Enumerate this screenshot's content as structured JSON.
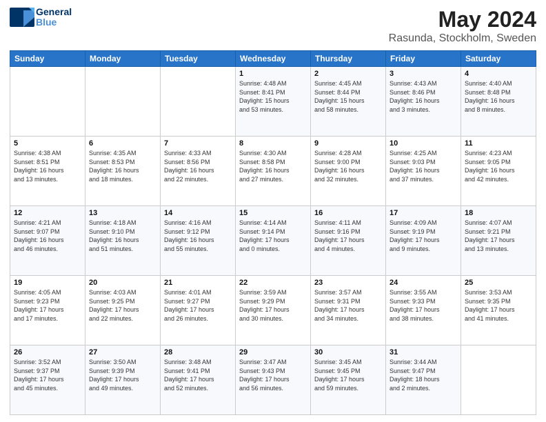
{
  "header": {
    "logo_general": "General",
    "logo_blue": "Blue",
    "main_title": "May 2024",
    "subtitle": "Rasunda, Stockholm, Sweden"
  },
  "days_of_week": [
    "Sunday",
    "Monday",
    "Tuesday",
    "Wednesday",
    "Thursday",
    "Friday",
    "Saturday"
  ],
  "weeks": [
    [
      {
        "day": "",
        "info": ""
      },
      {
        "day": "",
        "info": ""
      },
      {
        "day": "",
        "info": ""
      },
      {
        "day": "1",
        "info": "Sunrise: 4:48 AM\nSunset: 8:41 PM\nDaylight: 15 hours\nand 53 minutes."
      },
      {
        "day": "2",
        "info": "Sunrise: 4:45 AM\nSunset: 8:44 PM\nDaylight: 15 hours\nand 58 minutes."
      },
      {
        "day": "3",
        "info": "Sunrise: 4:43 AM\nSunset: 8:46 PM\nDaylight: 16 hours\nand 3 minutes."
      },
      {
        "day": "4",
        "info": "Sunrise: 4:40 AM\nSunset: 8:48 PM\nDaylight: 16 hours\nand 8 minutes."
      }
    ],
    [
      {
        "day": "5",
        "info": "Sunrise: 4:38 AM\nSunset: 8:51 PM\nDaylight: 16 hours\nand 13 minutes."
      },
      {
        "day": "6",
        "info": "Sunrise: 4:35 AM\nSunset: 8:53 PM\nDaylight: 16 hours\nand 18 minutes."
      },
      {
        "day": "7",
        "info": "Sunrise: 4:33 AM\nSunset: 8:56 PM\nDaylight: 16 hours\nand 22 minutes."
      },
      {
        "day": "8",
        "info": "Sunrise: 4:30 AM\nSunset: 8:58 PM\nDaylight: 16 hours\nand 27 minutes."
      },
      {
        "day": "9",
        "info": "Sunrise: 4:28 AM\nSunset: 9:00 PM\nDaylight: 16 hours\nand 32 minutes."
      },
      {
        "day": "10",
        "info": "Sunrise: 4:25 AM\nSunset: 9:03 PM\nDaylight: 16 hours\nand 37 minutes."
      },
      {
        "day": "11",
        "info": "Sunrise: 4:23 AM\nSunset: 9:05 PM\nDaylight: 16 hours\nand 42 minutes."
      }
    ],
    [
      {
        "day": "12",
        "info": "Sunrise: 4:21 AM\nSunset: 9:07 PM\nDaylight: 16 hours\nand 46 minutes."
      },
      {
        "day": "13",
        "info": "Sunrise: 4:18 AM\nSunset: 9:10 PM\nDaylight: 16 hours\nand 51 minutes."
      },
      {
        "day": "14",
        "info": "Sunrise: 4:16 AM\nSunset: 9:12 PM\nDaylight: 16 hours\nand 55 minutes."
      },
      {
        "day": "15",
        "info": "Sunrise: 4:14 AM\nSunset: 9:14 PM\nDaylight: 17 hours\nand 0 minutes."
      },
      {
        "day": "16",
        "info": "Sunrise: 4:11 AM\nSunset: 9:16 PM\nDaylight: 17 hours\nand 4 minutes."
      },
      {
        "day": "17",
        "info": "Sunrise: 4:09 AM\nSunset: 9:19 PM\nDaylight: 17 hours\nand 9 minutes."
      },
      {
        "day": "18",
        "info": "Sunrise: 4:07 AM\nSunset: 9:21 PM\nDaylight: 17 hours\nand 13 minutes."
      }
    ],
    [
      {
        "day": "19",
        "info": "Sunrise: 4:05 AM\nSunset: 9:23 PM\nDaylight: 17 hours\nand 17 minutes."
      },
      {
        "day": "20",
        "info": "Sunrise: 4:03 AM\nSunset: 9:25 PM\nDaylight: 17 hours\nand 22 minutes."
      },
      {
        "day": "21",
        "info": "Sunrise: 4:01 AM\nSunset: 9:27 PM\nDaylight: 17 hours\nand 26 minutes."
      },
      {
        "day": "22",
        "info": "Sunrise: 3:59 AM\nSunset: 9:29 PM\nDaylight: 17 hours\nand 30 minutes."
      },
      {
        "day": "23",
        "info": "Sunrise: 3:57 AM\nSunset: 9:31 PM\nDaylight: 17 hours\nand 34 minutes."
      },
      {
        "day": "24",
        "info": "Sunrise: 3:55 AM\nSunset: 9:33 PM\nDaylight: 17 hours\nand 38 minutes."
      },
      {
        "day": "25",
        "info": "Sunrise: 3:53 AM\nSunset: 9:35 PM\nDaylight: 17 hours\nand 41 minutes."
      }
    ],
    [
      {
        "day": "26",
        "info": "Sunrise: 3:52 AM\nSunset: 9:37 PM\nDaylight: 17 hours\nand 45 minutes."
      },
      {
        "day": "27",
        "info": "Sunrise: 3:50 AM\nSunset: 9:39 PM\nDaylight: 17 hours\nand 49 minutes."
      },
      {
        "day": "28",
        "info": "Sunrise: 3:48 AM\nSunset: 9:41 PM\nDaylight: 17 hours\nand 52 minutes."
      },
      {
        "day": "29",
        "info": "Sunrise: 3:47 AM\nSunset: 9:43 PM\nDaylight: 17 hours\nand 56 minutes."
      },
      {
        "day": "30",
        "info": "Sunrise: 3:45 AM\nSunset: 9:45 PM\nDaylight: 17 hours\nand 59 minutes."
      },
      {
        "day": "31",
        "info": "Sunrise: 3:44 AM\nSunset: 9:47 PM\nDaylight: 18 hours\nand 2 minutes."
      },
      {
        "day": "",
        "info": ""
      }
    ]
  ]
}
